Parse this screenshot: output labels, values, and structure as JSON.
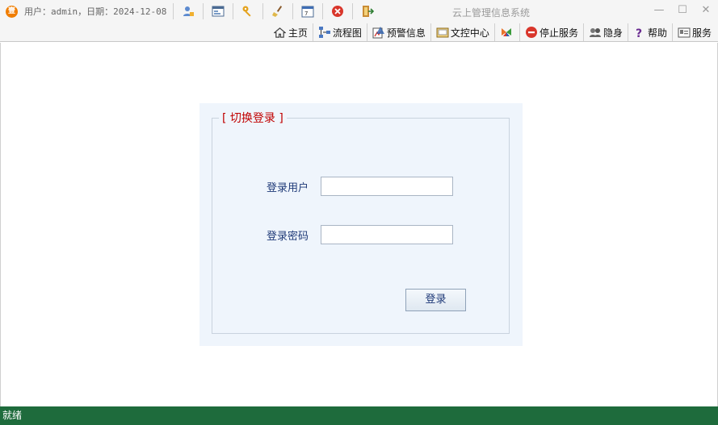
{
  "titlebar": {
    "app_icon_char": "壹",
    "user_info": "用户：admin，日期：2024-12-08",
    "window_title": "云上管理信息系统",
    "quick_tools": [
      "user-icon",
      "window-icon",
      "key-icon",
      "broom-icon",
      "calendar-icon",
      "close-circle-icon",
      "exit-icon"
    ],
    "controls": {
      "minimize": "—",
      "maximize": "☐",
      "close": "✕"
    }
  },
  "toolbar": {
    "items": [
      {
        "label": "主页",
        "icon": "home-icon"
      },
      {
        "label": "流程图",
        "icon": "flowchart-icon"
      },
      {
        "label": "预警信息",
        "icon": "warning-icon"
      },
      {
        "label": "文控中心",
        "icon": "document-center-icon"
      },
      {
        "label": "",
        "icon": "butterfly-icon"
      },
      {
        "label": "停止服务",
        "icon": "stop-icon"
      },
      {
        "label": "隐身",
        "icon": "stealth-icon"
      },
      {
        "label": "帮助",
        "icon": "help-icon"
      },
      {
        "label": "服务",
        "icon": "service-icon"
      }
    ]
  },
  "login": {
    "legend": "[ 切换登录 ]",
    "user_label": "登录用户",
    "user_value": "",
    "password_label": "登录密码",
    "password_value": "",
    "submit_label": "登录"
  },
  "status": {
    "text": "就绪"
  },
  "colors": {
    "status_bar": "#1e6b3c",
    "legend": "#c00000",
    "panel": "#eff5fc",
    "label": "#1f3a78"
  }
}
